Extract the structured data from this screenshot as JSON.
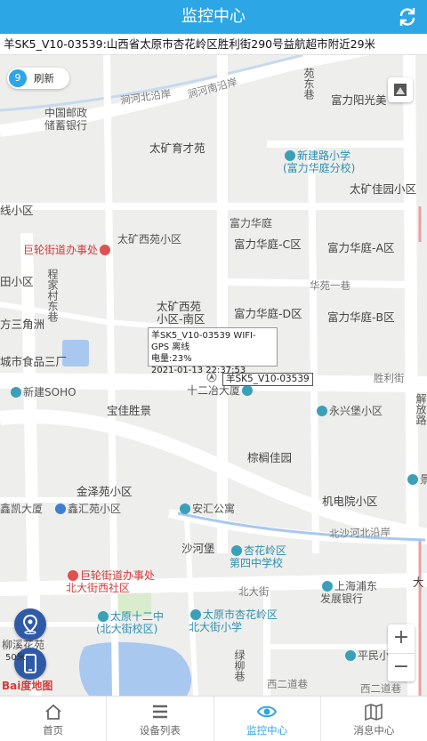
{
  "header": {
    "title": "监控中心",
    "refresh_icon": "refresh-icon"
  },
  "address": "羊SK5_V10-03539:山西省太原市杏花岭区胜利街290号益航超市附近29米",
  "map": {
    "refresh_count": "9",
    "refresh_label": "刷新",
    "info_popup": {
      "line1": "羊SK5_V10-03539 WIFI-GPS 离线",
      "line2": "电量:23%",
      "line3": "2021-01-13 22:37:53"
    },
    "device_label": "羊SK5_V10-03539",
    "scale": "50米",
    "attribution": "Bai度地图",
    "zoom_in": "+",
    "zoom_out": "−",
    "labels": {
      "l1": "涧河北沿岸",
      "l2": "涧河南沿岸",
      "l3": "中国邮政\n储蓄银行",
      "l4": "富力阳光美",
      "l5": "苑东巷",
      "l6": "太矿育才苑",
      "l7": "新建路小学\n(富力华庭分校)",
      "l8": "太矿佳园小区",
      "l9": "线小区",
      "l10": "富力华庭",
      "l11": "巨轮街道办事处",
      "l12": "太矿西苑小区",
      "l13": "富力华庭-C区",
      "l14": "富力华庭-A区",
      "l15": "田小区",
      "l16": "程家村东巷",
      "l17": "华苑一巷",
      "l18": "太矿西苑\n小区-南区",
      "l19": "富力华庭-D区",
      "l20": "富力华庭-B区",
      "l21": "方三角洲",
      "l22": "胜利街",
      "l23": "新建SOHO",
      "l24": "十二冶大厦",
      "l25": "宝佳胜景",
      "l26": "永兴堡小区",
      "l27": "棕榈佳园",
      "l28": "金泽苑小区",
      "l29": "鑫凯大厦",
      "l30": "鑫汇苑小区",
      "l31": "安汇公寓",
      "l32": "机电院小区",
      "l33": "北沙河北沿岸",
      "l34": "沙河堡",
      "l35": "杏花岭区\n第四中学校",
      "l36": "巨轮街道办事处\n北大街西社区",
      "l37": "北大街",
      "l38": "上海浦东\n发展银行",
      "l39": "太原十二中\n(北大街校区)",
      "l40": "太原市杏花岭区\n北大街小学",
      "l41": "绿柳巷",
      "l42": "西二道巷",
      "l43": "西二道巷",
      "l44": "平民小区",
      "l45": "大",
      "l46": "城市食品三厂",
      "l47": "解放路",
      "l48": "景",
      "l49": "柳溪花苑"
    }
  },
  "tabs": [
    {
      "label": "首页",
      "icon": "home-icon"
    },
    {
      "label": "设备列表",
      "icon": "list-icon"
    },
    {
      "label": "监控中心",
      "icon": "eye-icon"
    },
    {
      "label": "消息中心",
      "icon": "map-book-icon"
    }
  ],
  "colors": {
    "accent": "#2da6e6",
    "road": "#ffffff",
    "water": "#a9c8f0",
    "button": "#2e5aa8"
  }
}
